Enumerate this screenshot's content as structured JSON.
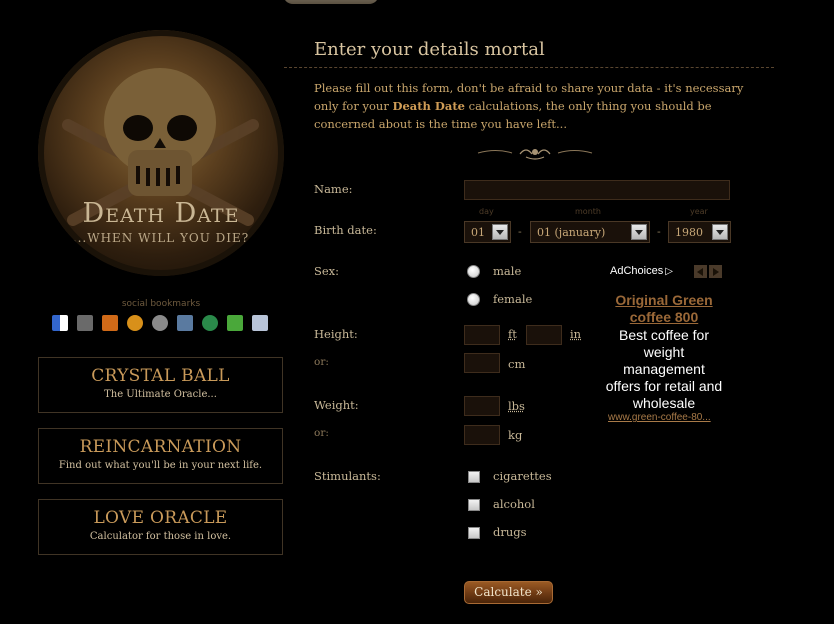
{
  "logo": {
    "title": "Death Date",
    "subtitle": "...WHEN WILL YOU DIE?"
  },
  "social": {
    "label": "social bookmarks"
  },
  "cards": [
    {
      "title": "CRYSTAL BALL",
      "subtitle": "The Ultimate Oracle..."
    },
    {
      "title": "REINCARNATION",
      "subtitle": "Find out what you'll be in your next life."
    },
    {
      "title": "LOVE ORACLE",
      "subtitle": "Calculator for those in love."
    }
  ],
  "main": {
    "title": "Enter your details mortal",
    "intro_a": "Please fill out this form, don't be afraid to share your data - it's necessary only for your ",
    "intro_bold": "Death Date",
    "intro_b": " calculations, the only thing you should be concerned about is the time you have left..."
  },
  "form": {
    "name_label": "Name:",
    "name_value": "",
    "birth_label": "Birth date:",
    "day_hint": "day",
    "month_hint": "month",
    "year_hint": "year",
    "day_value": "01",
    "month_value": "01 (january)",
    "year_value": "1980",
    "dash": "-",
    "sex_label": "Sex:",
    "male": "male",
    "female": "female",
    "height_label": "Height:",
    "or1": "or:",
    "ft": "ft",
    "in": "in",
    "cm": "cm",
    "weight_label": "Weight:",
    "or2": "or:",
    "lbs": "lbs",
    "kg": "kg",
    "stim_label": "Stimulants:",
    "cigarettes": "cigarettes",
    "alcohol": "alcohol",
    "drugs": "drugs",
    "calculate": "Calculate »"
  },
  "ad": {
    "choices": "AdChoices",
    "title": "Original Green coffee 800",
    "body": "Best coffee for weight management offers for retail and wholesale",
    "url": "www.green-coffee-80..."
  },
  "colors": {
    "accent": "#c99a5a",
    "background": "#000000",
    "button": "#7a4218"
  }
}
